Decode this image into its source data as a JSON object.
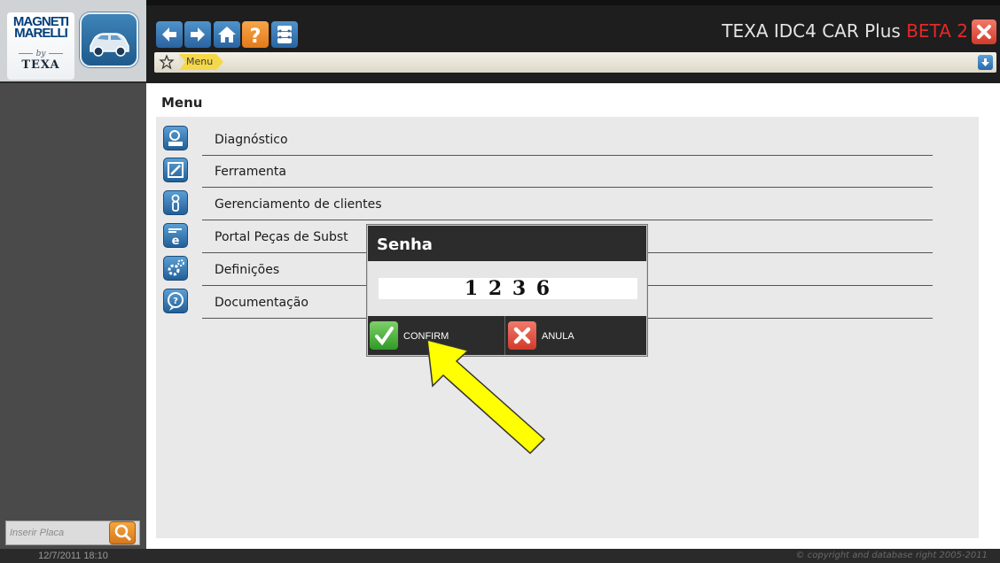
{
  "app": {
    "title_main": "TEXA IDC4 CAR Plus ",
    "title_beta": "BETA 2"
  },
  "logo": {
    "brand_top": "MAGNETI MARELLI",
    "brand_by": "by",
    "brand_bottom": "TEXA"
  },
  "toolbar": {
    "icons": [
      "arrow-left-icon",
      "arrow-right-icon",
      "home-icon",
      "help-icon",
      "garage-icon"
    ],
    "help_glyph": "?"
  },
  "breadcrumb": {
    "items": [
      "Menu"
    ]
  },
  "main": {
    "title": "Menu",
    "items": [
      {
        "label": "Diagnóstico",
        "icon": "diagnosis-icon"
      },
      {
        "label": "Ferramenta",
        "icon": "tools-icon"
      },
      {
        "label": "Gerenciamento de clientes",
        "icon": "customer-management-icon"
      },
      {
        "label": "Portal Peças de Subst",
        "icon": "parts-portal-icon"
      },
      {
        "label": "Definições",
        "icon": "settings-icon"
      },
      {
        "label": "Documentação",
        "icon": "documentation-icon"
      }
    ]
  },
  "sidebar": {
    "plate_placeholder": "Inserir Placa",
    "datetime": "12/7/2011 18:10"
  },
  "footer": {
    "copyright": "© copyright and database right 2005-2011"
  },
  "dialog": {
    "title": "Senha",
    "password_value": "1 2 3 6",
    "confirm_label": "CONFIRM",
    "cancel_label": "ANULA"
  },
  "colors": {
    "accent_blue": "#2a64a0",
    "beta_red": "#e42828",
    "breadcrumb_yellow": "#f5d84a",
    "pointer_arrow_yellow": "#ffff00"
  }
}
